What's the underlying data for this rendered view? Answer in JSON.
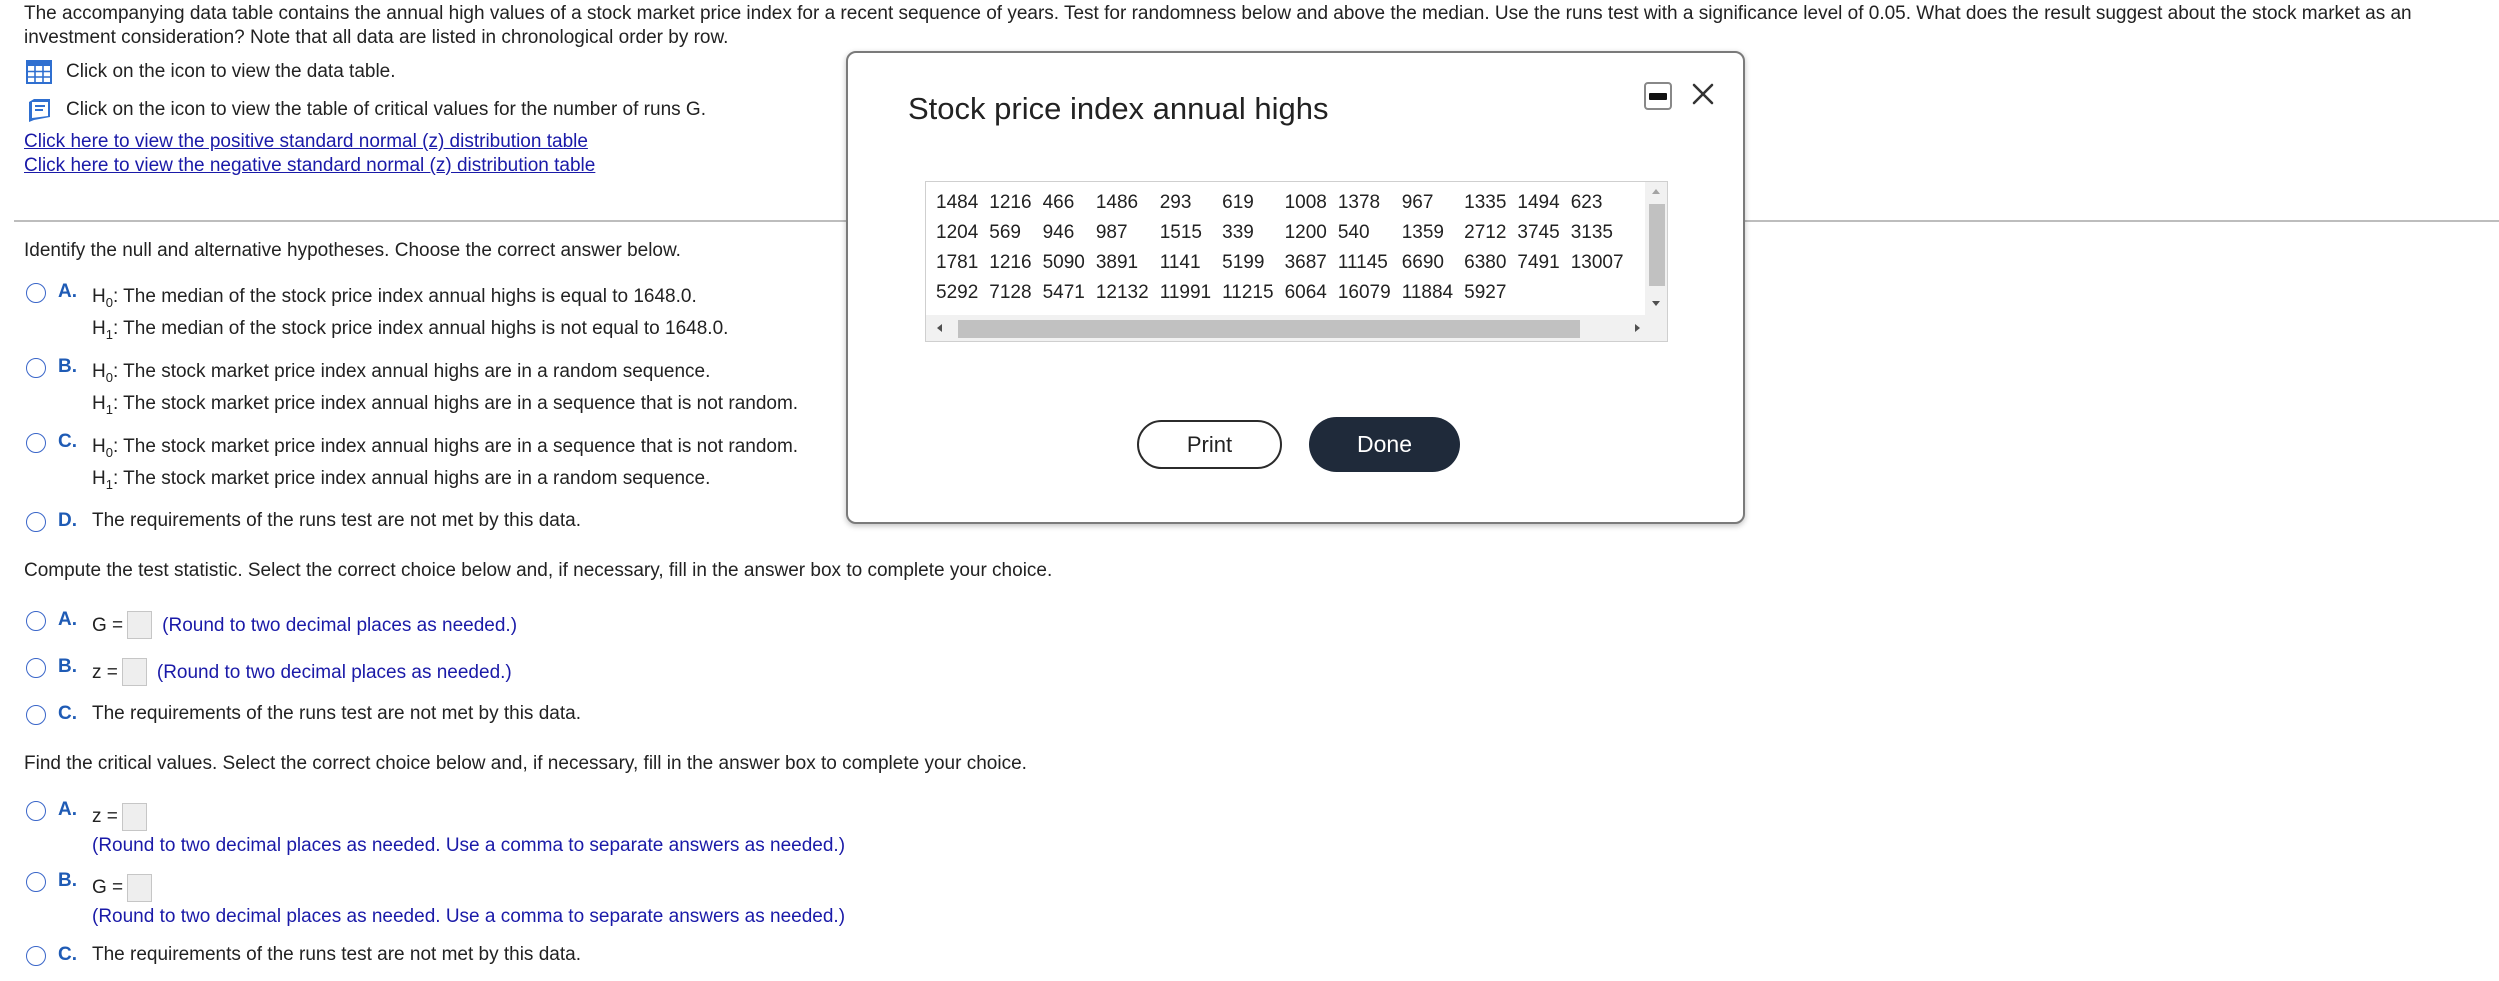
{
  "intro": {
    "text": "The accompanying data table contains the annual high values of a stock market price index for a recent sequence of years. Test for randomness below and above the median. Use the runs test with a significance level of 0.05. What does the result suggest about the stock market as an investment consideration? Note that all data are listed in chronological order by row."
  },
  "links": {
    "data_table": "Click on the icon to view the data table.",
    "critical_values": "Click on the icon to view the table of critical values for the number of runs G.",
    "positive_z": "Click here to view the positive standard normal (z) distribution table",
    "negative_z": "Click here to view the negative standard normal (z) distribution table"
  },
  "q1": {
    "prompt": "Identify the null and alternative hypotheses. Choose the correct answer below.",
    "options": [
      {
        "letter": "A.",
        "h0": ": The median of the stock price index annual highs is equal to 1648.0.",
        "h1": ": The median of the stock price index annual highs is not equal to 1648.0."
      },
      {
        "letter": "B.",
        "h0": ": The stock market price index annual highs are in a random sequence.",
        "h1": ": The stock market price index annual highs are in a sequence that is not random."
      },
      {
        "letter": "C.",
        "h0": ": The stock market price index annual highs are in a sequence that is not random.",
        "h1": ": The stock market price index annual highs are in a random sequence."
      },
      {
        "letter": "D.",
        "text": "The requirements of the runs test are not met by this data."
      }
    ]
  },
  "q2": {
    "prompt": "Compute the test statistic. Select the correct choice below and, if necessary, fill in the answer box to complete your choice.",
    "options": [
      {
        "letter": "A.",
        "var": "G =",
        "hint": "(Round to two decimal places as needed.)"
      },
      {
        "letter": "B.",
        "var": "z =",
        "hint": "(Round to two decimal places as needed.)"
      },
      {
        "letter": "C.",
        "text": "The requirements of the runs test are not met by this data."
      }
    ]
  },
  "q3": {
    "prompt": "Find the critical values. Select the correct choice below and, if necessary, fill in the answer box to complete your choice.",
    "options": [
      {
        "letter": "A.",
        "var": "z =",
        "hint": "(Round to two decimal places as needed. Use a comma to separate answers as needed.)"
      },
      {
        "letter": "B.",
        "var": "G =",
        "hint": "(Round to two decimal places as needed. Use a comma to separate answers as needed.)"
      },
      {
        "letter": "C.",
        "text": "The requirements of the runs test are not met by this data."
      }
    ]
  },
  "modal": {
    "title": "Stock price index annual highs",
    "rows": [
      [
        "1484",
        "1216",
        "466",
        "1486",
        "293",
        "619",
        "1008",
        "1378",
        "967",
        "1335",
        "1494",
        "623"
      ],
      [
        "1204",
        "569",
        "946",
        "987",
        "1515",
        "339",
        "1200",
        "540",
        "1359",
        "2712",
        "3745",
        "3135"
      ],
      [
        "1781",
        "1216",
        "5090",
        "3891",
        "1141",
        "5199",
        "3687",
        "11145",
        "6690",
        "6380",
        "7491",
        "13007"
      ],
      [
        "5292",
        "7128",
        "5471",
        "12132",
        "11991",
        "11215",
        "6064",
        "16079",
        "11884",
        "5927"
      ]
    ],
    "print_label": "Print",
    "done_label": "Done"
  },
  "h_labels": {
    "h": "H",
    "sub0": "0",
    "sub1": "1"
  },
  "icons": {
    "table": "table-grid-icon",
    "book": "book-icon",
    "minimize": "minimize-icon",
    "close": "close-icon"
  },
  "colors": {
    "link": "#1a1aa8",
    "option_letter": "#1f5bb5",
    "radio": "#3a66c9",
    "done_button": "#1f2a3a"
  }
}
